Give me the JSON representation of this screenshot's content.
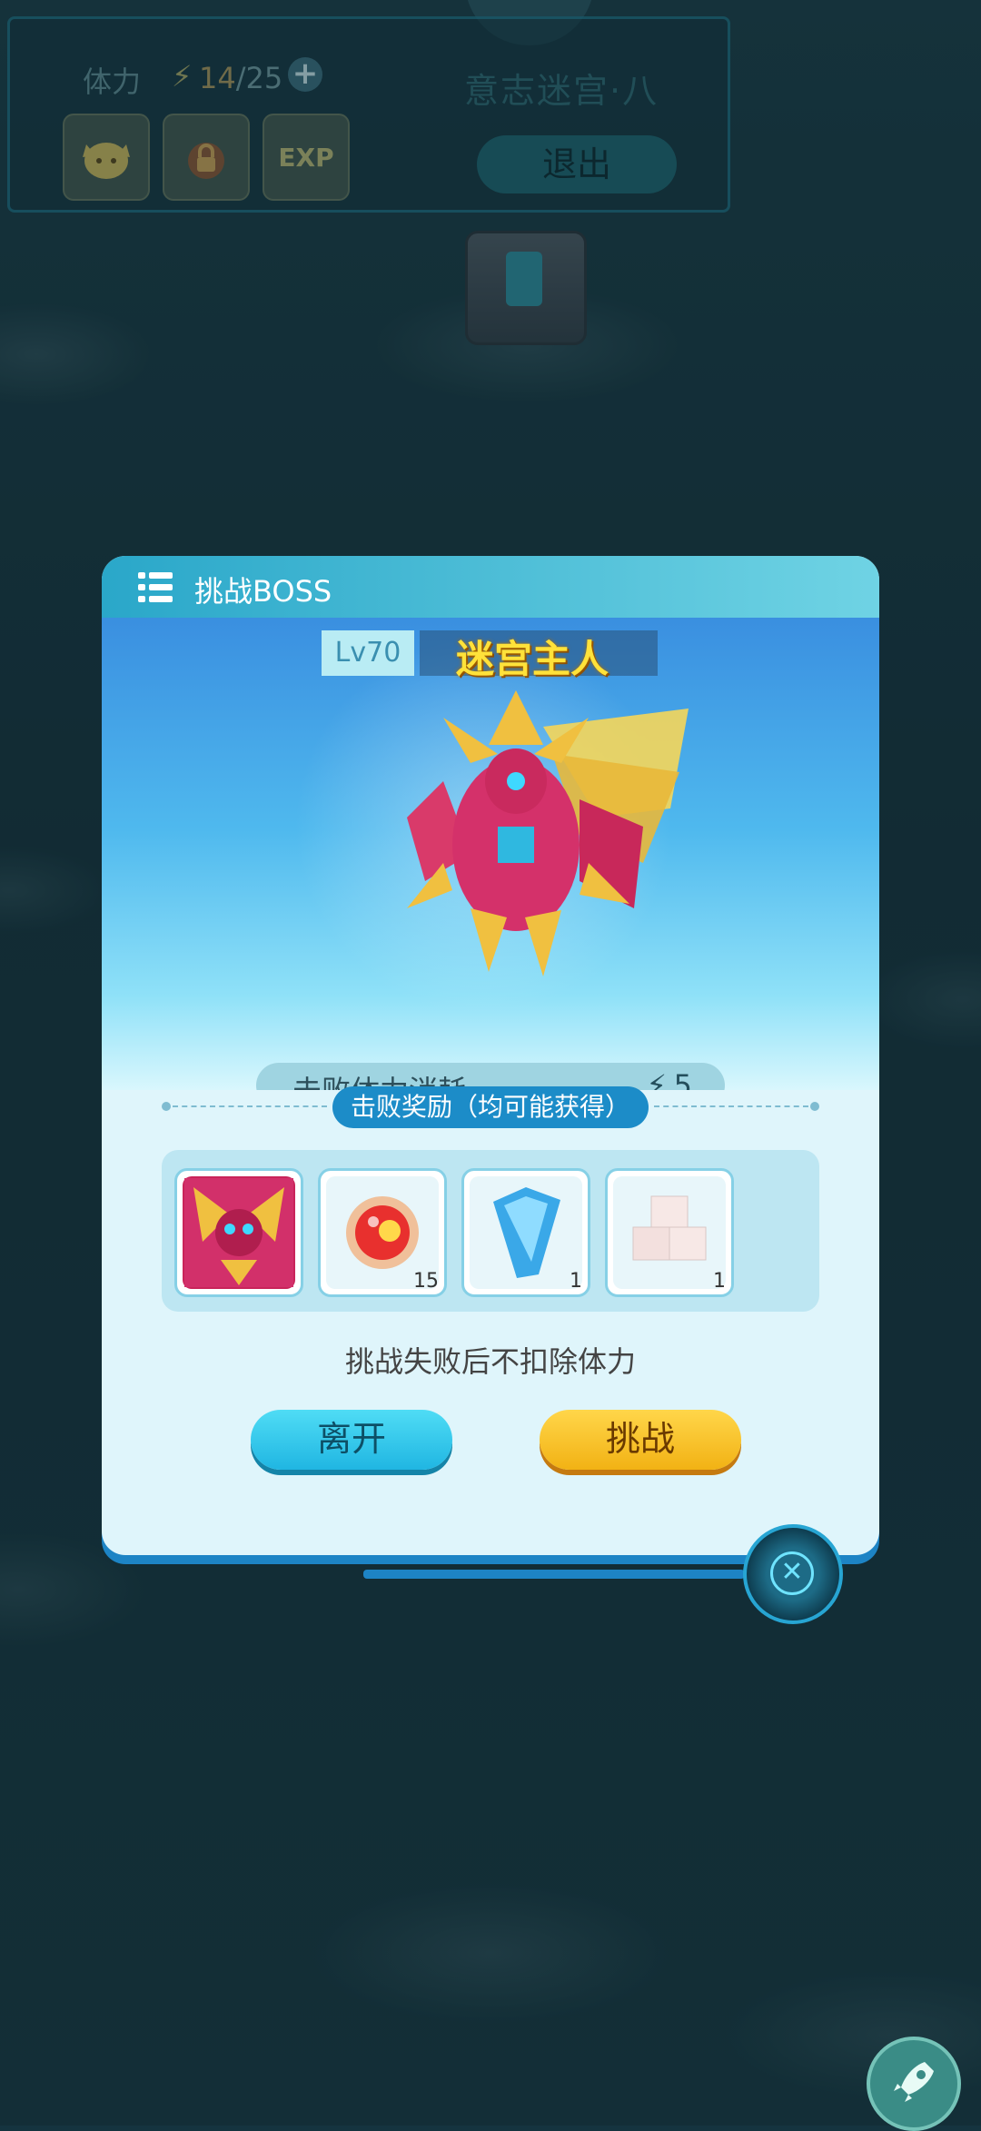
{
  "hud": {
    "stamina_label": "体力",
    "stamina_current": "14",
    "stamina_max": "/25",
    "add_label": "+",
    "items": [
      {
        "icon": "cat-food-icon"
      },
      {
        "icon": "lock-potion-icon"
      },
      {
        "icon": "exp-potion-icon",
        "label": "EXP"
      }
    ],
    "stage_title": "意志迷宫·八",
    "exit_label": "退出"
  },
  "dialog": {
    "title": "挑战BOSS",
    "boss_level": "Lv70",
    "boss_name": "迷宫主人",
    "cost_label": "击败体力消耗",
    "cost_value": "5",
    "rewards_label": "击败奖励（均可能获得）",
    "rewards": [
      {
        "icon": "boss-portrait-icon",
        "count": ""
      },
      {
        "icon": "fire-orb-icon",
        "count": "15"
      },
      {
        "icon": "blue-crystal-icon",
        "count": "1"
      },
      {
        "icon": "sugar-cube-icon",
        "count": "1"
      }
    ],
    "note": "挑战失败后不扣除体力",
    "leave_label": "离开",
    "challenge_label": "挑战"
  },
  "colors": {
    "accent_blue": "#1c8cc8",
    "button_cyan": "#20b6e2",
    "button_yellow": "#f2b214",
    "boss_name_yellow": "#ffe23a"
  }
}
